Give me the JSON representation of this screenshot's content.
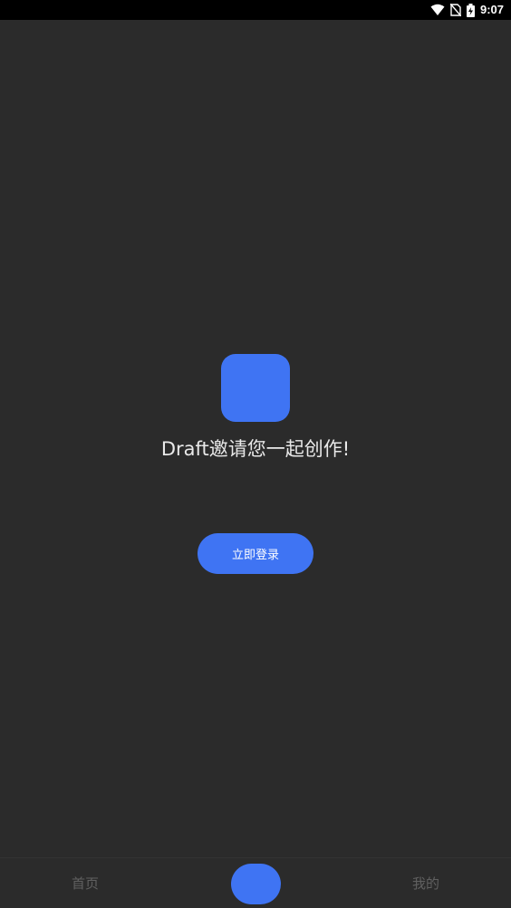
{
  "status_bar": {
    "time": "9:07",
    "icons": [
      "wifi-icon",
      "no-sim-icon",
      "battery-charging-icon"
    ]
  },
  "main": {
    "invite_text": "Draft邀请您一起创作!",
    "login_button_label": "立即登录"
  },
  "bottom_nav": {
    "home_label": "首页",
    "mine_label": "我的"
  },
  "colors": {
    "background": "#2b2b2b",
    "accent": "#3f74f3",
    "inactive_text": "#606060"
  }
}
